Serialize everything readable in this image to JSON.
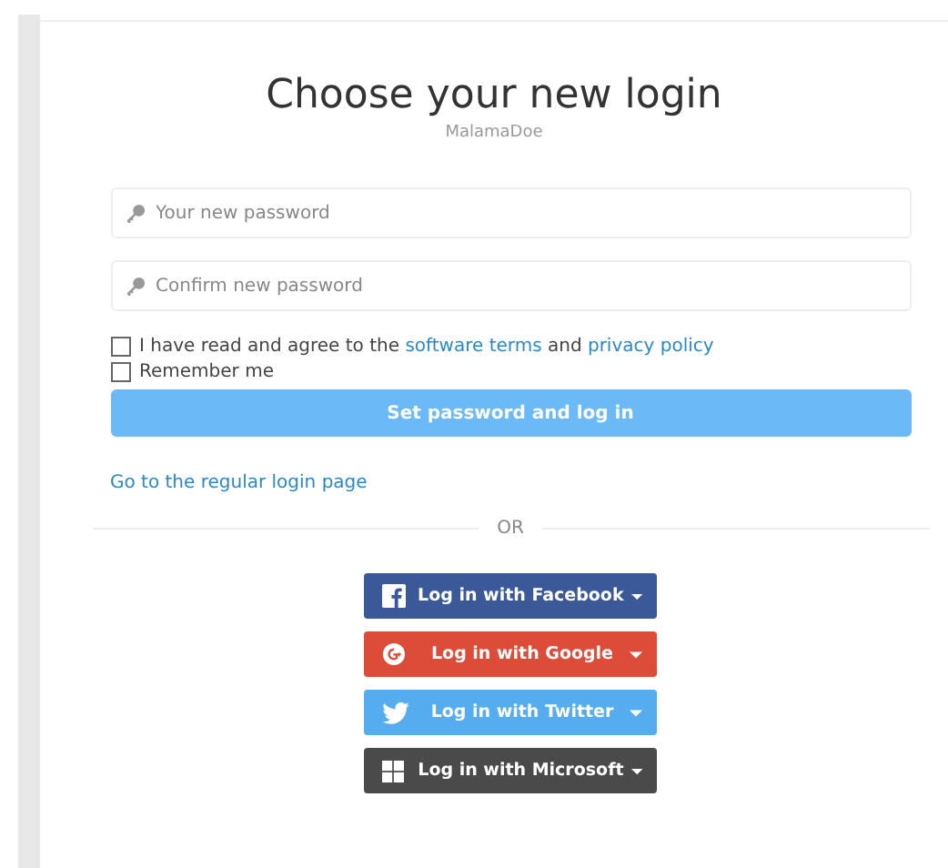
{
  "title": "Choose your new login",
  "username": "MalamaDoe",
  "fields": [
    {
      "placeholder": "Your new password"
    },
    {
      "placeholder": "Confirm new password"
    }
  ],
  "checkboxes": [
    {
      "parts": [
        "I have read and agree to the ",
        "software terms",
        " and ",
        "privacy policy"
      ],
      "checked": false
    },
    {
      "label": "Remember me",
      "checked": false
    }
  ],
  "submit": "Set password and log in",
  "regular_login_link": "Go to the regular login page",
  "separator": "OR",
  "social": [
    {
      "kind": "facebook",
      "label": "Log in with Facebook",
      "color": "#3b5998"
    },
    {
      "kind": "google",
      "label": "Log in with Google",
      "color": "#dd4b39"
    },
    {
      "kind": "twitter",
      "label": "Log in with Twitter",
      "color": "#55acee"
    },
    {
      "kind": "microsoft",
      "label": "Log in with Microsoft",
      "color": "#4a4a4a"
    }
  ]
}
